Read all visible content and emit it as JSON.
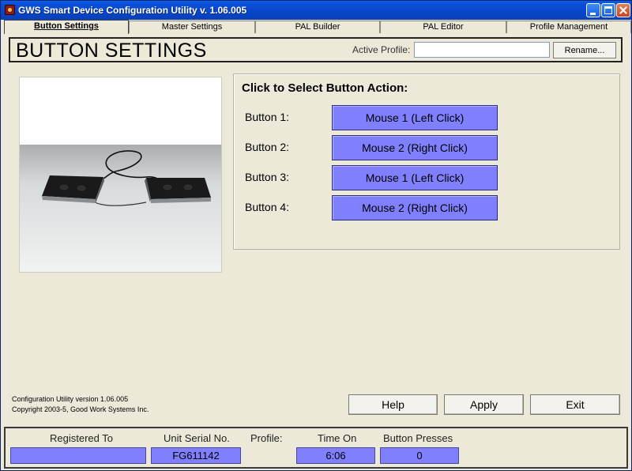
{
  "window": {
    "title": "GWS Smart Device Configuration Utility v. 1.06.005"
  },
  "tabs": [
    {
      "label": "Button Settings",
      "active": true
    },
    {
      "label": "Master Settings"
    },
    {
      "label": "PAL Builder"
    },
    {
      "label": "PAL Editor"
    },
    {
      "label": "Profile Management"
    }
  ],
  "header": {
    "title": "BUTTON SETTINGS",
    "profile_label": "Active Profile:",
    "profile_value": "",
    "rename_label": "Rename..."
  },
  "actions": {
    "heading": "Click to Select Button Action:",
    "rows": [
      {
        "label": "Button 1:",
        "action": "Mouse 1 (Left Click)"
      },
      {
        "label": "Button 2:",
        "action": "Mouse 2 (Right Click)"
      },
      {
        "label": "Button 3:",
        "action": "Mouse 1 (Left Click)"
      },
      {
        "label": "Button 4:",
        "action": "Mouse 2 (Right Click)"
      }
    ]
  },
  "footer": {
    "version_line": "Configuration Utility version 1.06.005",
    "copyright_line": "Copyright 2003-5, Good Work Systems Inc.",
    "help_label": "Help",
    "apply_label": "Apply",
    "exit_label": "Exit"
  },
  "status": {
    "registered_label": "Registered To",
    "registered_value": "",
    "serial_label": "Unit Serial No.",
    "serial_value": "FG611142",
    "profile_label": "Profile:",
    "time_label": "Time On",
    "time_value": "6:06",
    "presses_label": "Button Presses",
    "presses_value": "0"
  },
  "colors": {
    "action_button": "#8080FF",
    "window_bg": "#ECE9D8",
    "titlebar": "#0846C8"
  },
  "icons": {
    "app": "app-icon",
    "minimize": "minimize-icon",
    "maximize": "maximize-icon",
    "close": "close-icon"
  }
}
